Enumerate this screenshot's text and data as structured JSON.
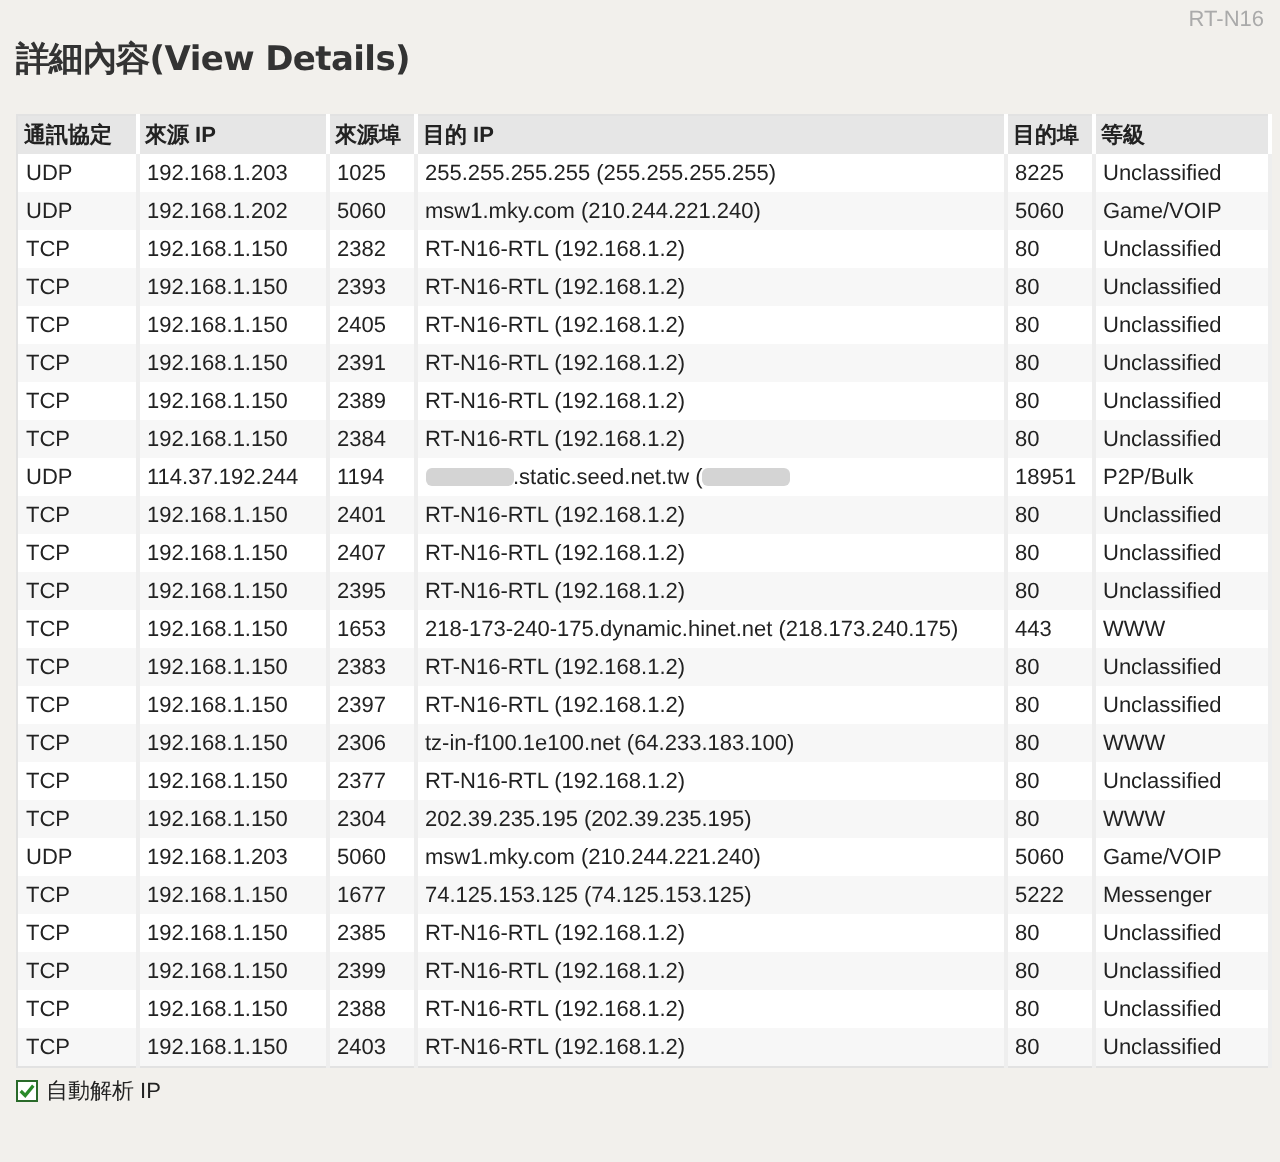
{
  "model": "RT-N16",
  "title": "詳細內容(View Details)",
  "table": {
    "columns": [
      "通訊協定",
      "來源 IP",
      "來源埠",
      "目的 IP",
      "目的埠",
      "等級"
    ],
    "rows": [
      {
        "protocol": "UDP",
        "src_ip": "192.168.1.203",
        "src_port": "1025",
        "dest_ip": "255.255.255.255 (255.255.255.255)",
        "dest_port": "8225",
        "level": "Unclassified"
      },
      {
        "protocol": "UDP",
        "src_ip": "192.168.1.202",
        "src_port": "5060",
        "dest_ip": "msw1.mky.com (210.244.221.240)",
        "dest_port": "5060",
        "level": "Game/VOIP"
      },
      {
        "protocol": "TCP",
        "src_ip": "192.168.1.150",
        "src_port": "2382",
        "dest_ip": "RT-N16-RTL (192.168.1.2)",
        "dest_port": "80",
        "level": "Unclassified"
      },
      {
        "protocol": "TCP",
        "src_ip": "192.168.1.150",
        "src_port": "2393",
        "dest_ip": "RT-N16-RTL (192.168.1.2)",
        "dest_port": "80",
        "level": "Unclassified"
      },
      {
        "protocol": "TCP",
        "src_ip": "192.168.1.150",
        "src_port": "2405",
        "dest_ip": "RT-N16-RTL (192.168.1.2)",
        "dest_port": "80",
        "level": "Unclassified"
      },
      {
        "protocol": "TCP",
        "src_ip": "192.168.1.150",
        "src_port": "2391",
        "dest_ip": "RT-N16-RTL (192.168.1.2)",
        "dest_port": "80",
        "level": "Unclassified"
      },
      {
        "protocol": "TCP",
        "src_ip": "192.168.1.150",
        "src_port": "2389",
        "dest_ip": "RT-N16-RTL (192.168.1.2)",
        "dest_port": "80",
        "level": "Unclassified"
      },
      {
        "protocol": "TCP",
        "src_ip": "192.168.1.150",
        "src_port": "2384",
        "dest_ip": "RT-N16-RTL (192.168.1.2)",
        "dest_port": "80",
        "level": "Unclassified"
      },
      {
        "protocol": "UDP",
        "src_ip": "114.37.192.244",
        "src_port": "1194",
        "dest_ip": ".static.seed.net.tw (",
        "redacted_before": true,
        "redacted_after": true,
        "dest_port": "18951",
        "level": "P2P/Bulk"
      },
      {
        "protocol": "TCP",
        "src_ip": "192.168.1.150",
        "src_port": "2401",
        "dest_ip": "RT-N16-RTL (192.168.1.2)",
        "dest_port": "80",
        "level": "Unclassified"
      },
      {
        "protocol": "TCP",
        "src_ip": "192.168.1.150",
        "src_port": "2407",
        "dest_ip": "RT-N16-RTL (192.168.1.2)",
        "dest_port": "80",
        "level": "Unclassified"
      },
      {
        "protocol": "TCP",
        "src_ip": "192.168.1.150",
        "src_port": "2395",
        "dest_ip": "RT-N16-RTL (192.168.1.2)",
        "dest_port": "80",
        "level": "Unclassified"
      },
      {
        "protocol": "TCP",
        "src_ip": "192.168.1.150",
        "src_port": "1653",
        "dest_ip": "218-173-240-175.dynamic.hinet.net (218.173.240.175)",
        "dest_port": "443",
        "level": "WWW"
      },
      {
        "protocol": "TCP",
        "src_ip": "192.168.1.150",
        "src_port": "2383",
        "dest_ip": "RT-N16-RTL (192.168.1.2)",
        "dest_port": "80",
        "level": "Unclassified"
      },
      {
        "protocol": "TCP",
        "src_ip": "192.168.1.150",
        "src_port": "2397",
        "dest_ip": "RT-N16-RTL (192.168.1.2)",
        "dest_port": "80",
        "level": "Unclassified"
      },
      {
        "protocol": "TCP",
        "src_ip": "192.168.1.150",
        "src_port": "2306",
        "dest_ip": "tz-in-f100.1e100.net (64.233.183.100)",
        "dest_port": "80",
        "level": "WWW"
      },
      {
        "protocol": "TCP",
        "src_ip": "192.168.1.150",
        "src_port": "2377",
        "dest_ip": "RT-N16-RTL (192.168.1.2)",
        "dest_port": "80",
        "level": "Unclassified"
      },
      {
        "protocol": "TCP",
        "src_ip": "192.168.1.150",
        "src_port": "2304",
        "dest_ip": "202.39.235.195 (202.39.235.195)",
        "dest_port": "80",
        "level": "WWW"
      },
      {
        "protocol": "UDP",
        "src_ip": "192.168.1.203",
        "src_port": "5060",
        "dest_ip": "msw1.mky.com (210.244.221.240)",
        "dest_port": "5060",
        "level": "Game/VOIP"
      },
      {
        "protocol": "TCP",
        "src_ip": "192.168.1.150",
        "src_port": "1677",
        "dest_ip": "74.125.153.125 (74.125.153.125)",
        "dest_port": "5222",
        "level": "Messenger"
      },
      {
        "protocol": "TCP",
        "src_ip": "192.168.1.150",
        "src_port": "2385",
        "dest_ip": "RT-N16-RTL (192.168.1.2)",
        "dest_port": "80",
        "level": "Unclassified"
      },
      {
        "protocol": "TCP",
        "src_ip": "192.168.1.150",
        "src_port": "2399",
        "dest_ip": "RT-N16-RTL (192.168.1.2)",
        "dest_port": "80",
        "level": "Unclassified"
      },
      {
        "protocol": "TCP",
        "src_ip": "192.168.1.150",
        "src_port": "2388",
        "dest_ip": "RT-N16-RTL (192.168.1.2)",
        "dest_port": "80",
        "level": "Unclassified"
      },
      {
        "protocol": "TCP",
        "src_ip": "192.168.1.150",
        "src_port": "2403",
        "dest_ip": "RT-N16-RTL (192.168.1.2)",
        "dest_port": "80",
        "level": "Unclassified"
      }
    ]
  },
  "auto_resolve": {
    "label": "自動解析 IP",
    "checked": true
  }
}
